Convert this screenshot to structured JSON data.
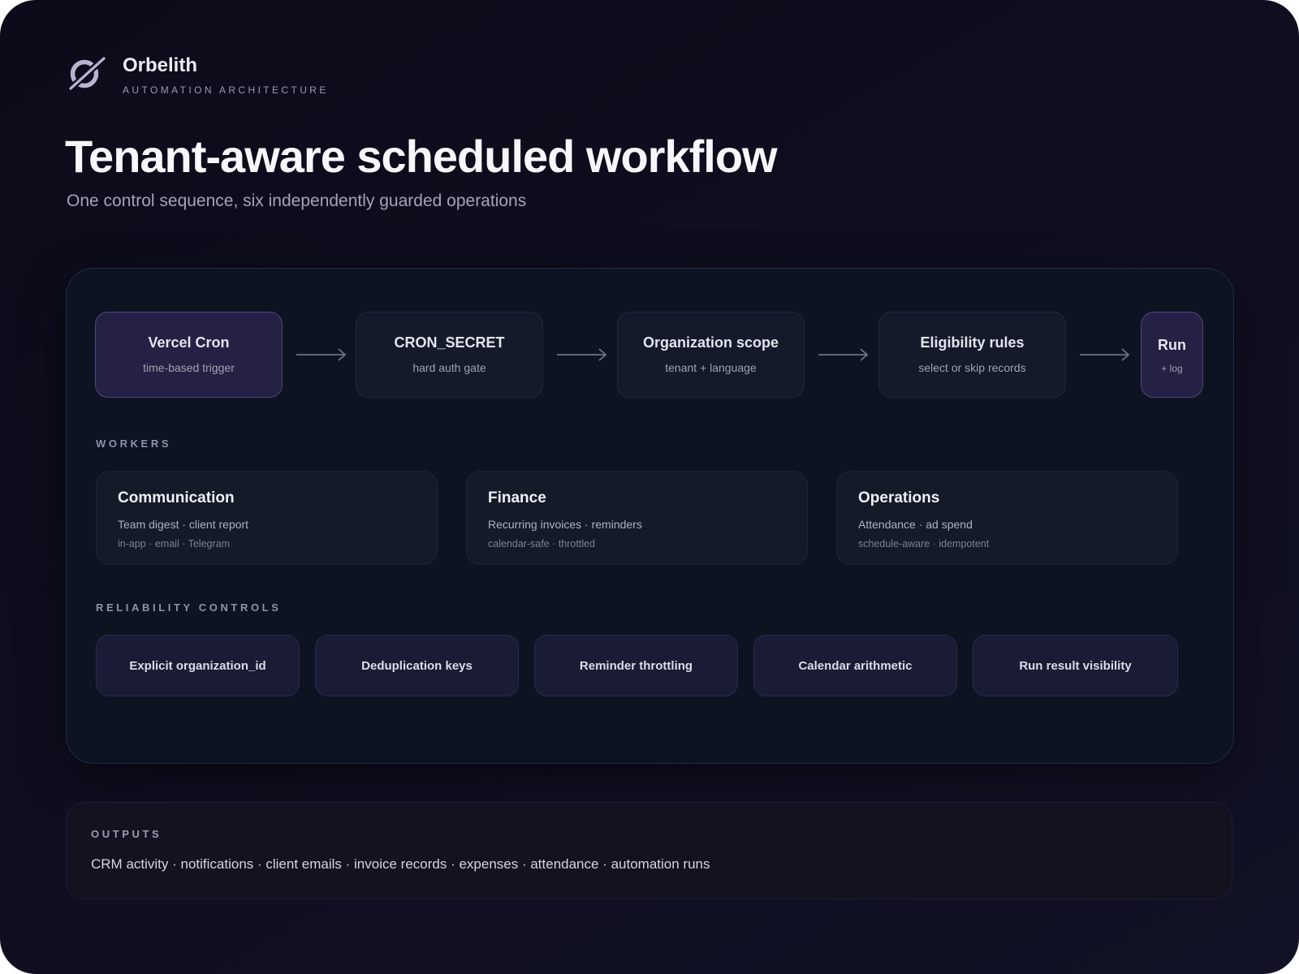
{
  "brand": {
    "name": "Orbelith",
    "subtitle": "AUTOMATION ARCHITECTURE",
    "logo_icon": "orbit-slash-icon"
  },
  "header": {
    "title": "Tenant-aware scheduled workflow",
    "subtitle": "One control sequence, six independently guarded operations"
  },
  "flow": {
    "steps": [
      {
        "title": "Vercel Cron",
        "desc": "time-based trigger"
      },
      {
        "title": "CRON_SECRET",
        "desc": "hard auth gate"
      },
      {
        "title": "Organization scope",
        "desc": "tenant + language"
      },
      {
        "title": "Eligibility rules",
        "desc": "select or skip records"
      },
      {
        "title": "Run",
        "desc": "+ log"
      }
    ]
  },
  "workers": {
    "label": "WORKERS",
    "items": [
      {
        "title": "Communication",
        "line1": "Team digest · client report",
        "line2": "in-app · email · Telegram"
      },
      {
        "title": "Finance",
        "line1": "Recurring invoices · reminders",
        "line2": "calendar-safe · throttled"
      },
      {
        "title": "Operations",
        "line1": "Attendance · ad spend",
        "line2": "schedule-aware · idempotent"
      }
    ]
  },
  "controls": {
    "label": "RELIABILITY CONTROLS",
    "items": [
      "Explicit organization_id",
      "Deduplication keys",
      "Reminder throttling",
      "Calendar arithmetic",
      "Run result visibility"
    ]
  },
  "outputs": {
    "label": "OUTPUTS",
    "text": "CRM activity · notifications · client emails · invoice records · expenses · attendance · automation runs"
  },
  "colors": {
    "background": "#0e0e1f",
    "panel": "#0e1322",
    "accent_box": "#252144",
    "control_box": "#1a1b35"
  }
}
